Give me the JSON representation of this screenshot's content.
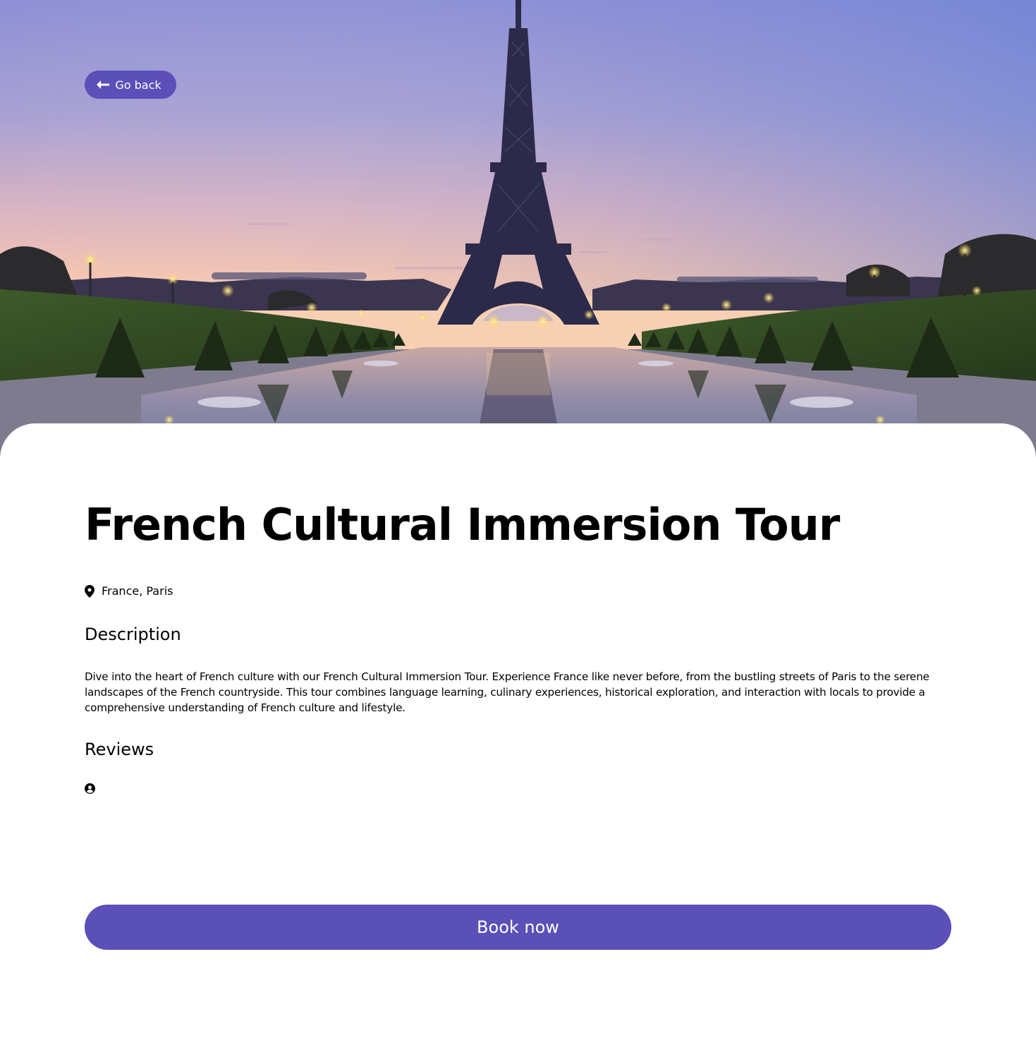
{
  "header": {
    "back_label": "Go back"
  },
  "tour": {
    "title": "French Cultural Immersion Tour",
    "location": "France, Paris"
  },
  "description": {
    "heading": "Description",
    "text": "Dive into the heart of French culture with our French Cultural Immersion Tour. Experience France like never before, from the bustling streets of Paris to the serene landscapes of the French countryside. This tour combines language learning, culinary experiences, historical exploration, and interaction with locals to provide a comprehensive understanding of French culture and lifestyle."
  },
  "reviews": {
    "heading": "Reviews",
    "items": []
  },
  "actions": {
    "book_label": "Book now"
  },
  "icons": {
    "back": "arrow-left-icon",
    "location": "map-pin-icon",
    "reviewer": "user-circle-icon"
  },
  "colors": {
    "accent": "#5b4fb8",
    "text": "#000000",
    "background": "#ffffff"
  }
}
